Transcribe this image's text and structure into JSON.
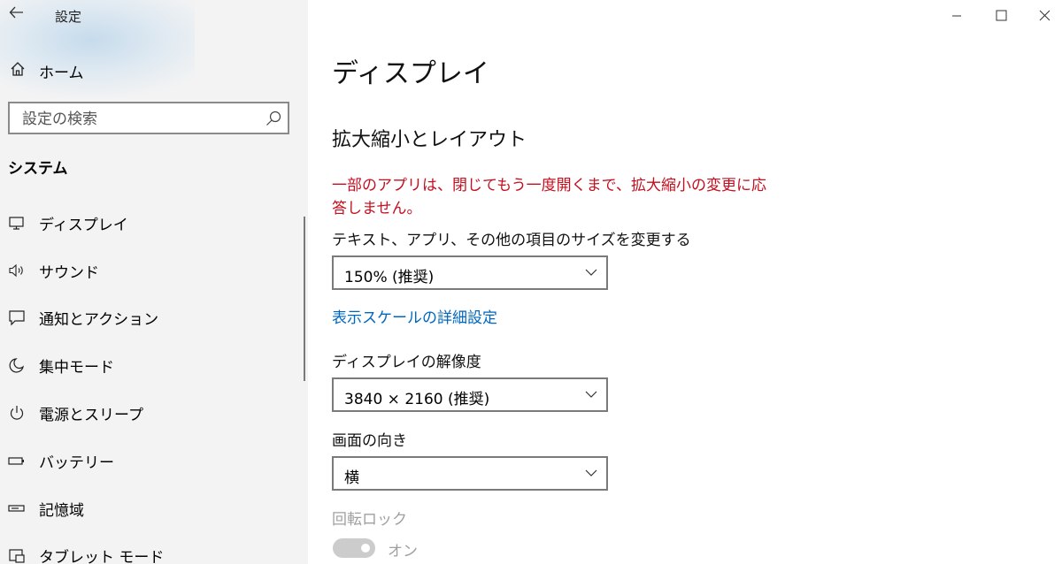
{
  "window": {
    "title": "設定",
    "controls": [
      "minimize-icon",
      "maximize-icon",
      "close-icon"
    ]
  },
  "sidebar": {
    "home_label": "ホーム",
    "search_placeholder": "設定の検索",
    "section_title": "システム",
    "items": [
      {
        "label": "ディスプレイ",
        "icon": "monitor-icon"
      },
      {
        "label": "サウンド",
        "icon": "speaker-icon"
      },
      {
        "label": "通知とアクション",
        "icon": "notification-icon"
      },
      {
        "label": "集中モード",
        "icon": "moon-icon"
      },
      {
        "label": "電源とスリープ",
        "icon": "power-icon"
      },
      {
        "label": "バッテリー",
        "icon": "battery-icon"
      },
      {
        "label": "記憶域",
        "icon": "storage-icon"
      },
      {
        "label": "タブレット モード",
        "icon": "tablet-mode-icon"
      }
    ]
  },
  "main": {
    "title": "ディスプレイ",
    "section_heading": "拡大縮小とレイアウト",
    "warning": "一部のアプリは、閉じてもう一度開くまで、拡大縮小の変更に応答しません。",
    "scale_label": "テキスト、アプリ、その他の項目のサイズを変更する",
    "scale_value": "150% (推奨)",
    "advanced_scaling_link": "表示スケールの詳細設定",
    "resolution_label": "ディスプレイの解像度",
    "resolution_value": "3840 × 2160 (推奨)",
    "orientation_label": "画面の向き",
    "orientation_value": "横",
    "rotation_lock_label": "回転ロック",
    "rotation_lock_state": "オン"
  },
  "colors": {
    "warning": "#c50f1f",
    "link": "#0067c0",
    "sidebar_bg": "#f3f3f3",
    "disabled": "#a0a0a0"
  }
}
